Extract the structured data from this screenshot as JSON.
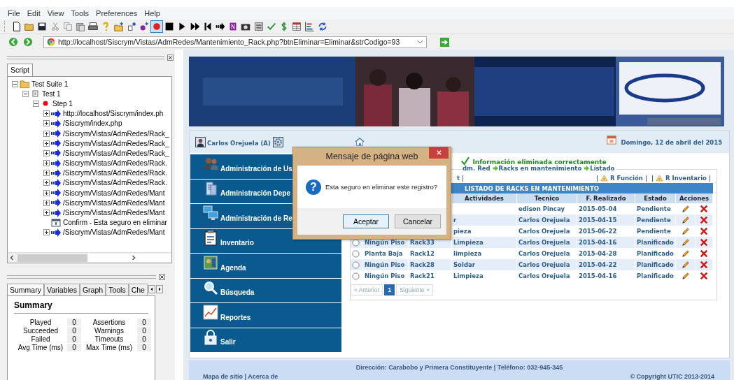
{
  "menu": [
    "File",
    "Edit",
    "View",
    "Tools",
    "Preferences",
    "Help"
  ],
  "toolbar": {
    "recording": true
  },
  "address": {
    "url": "http://localhost/Siscrym/Vistas/AdmRedes/Mantenimiento_Rack.php?btnEliminar=Eliminar&strCodigo=93"
  },
  "script_panel": {
    "tabs": [
      {
        "label": "Script",
        "selected": true
      }
    ],
    "tree": [
      {
        "kind": "suite",
        "label": "Test Suite 1",
        "expanded": true,
        "children": [
          {
            "kind": "test",
            "label": "Test 1",
            "expanded": true,
            "children": [
              {
                "kind": "step",
                "label": "Step 1",
                "expanded": true,
                "children": [
                  {
                    "kind": "request",
                    "label": "http://localhost/Siscrym/index.ph",
                    "expanded": false
                  },
                  {
                    "kind": "request",
                    "label": "/Siscrym/index.php",
                    "expanded": false
                  },
                  {
                    "kind": "request",
                    "label": "/Siscrym/Vistas/AdmRedes/Rack_",
                    "expanded": false
                  },
                  {
                    "kind": "request",
                    "label": "/Siscrym/Vistas/AdmRedes/Rack_",
                    "expanded": false
                  },
                  {
                    "kind": "request",
                    "label": "/Siscrym/Vistas/AdmRedes/Rack_",
                    "expanded": false
                  },
                  {
                    "kind": "request",
                    "label": "/Siscrym/Vistas/AdmRedes/Rack.",
                    "expanded": false
                  },
                  {
                    "kind": "request",
                    "label": "/Siscrym/Vistas/AdmRedes/Rack.",
                    "expanded": false
                  },
                  {
                    "kind": "request",
                    "label": "/Siscrym/Vistas/AdmRedes/Rack.",
                    "expanded": false
                  },
                  {
                    "kind": "request",
                    "label": "/Siscrym/Vistas/AdmRedes/Mant",
                    "expanded": false
                  },
                  {
                    "kind": "request",
                    "label": "/Siscrym/Vistas/AdmRedes/Mant",
                    "expanded": false
                  },
                  {
                    "kind": "request",
                    "label": "/Siscrym/Vistas/AdmRedes/Mant",
                    "expanded": false
                  },
                  {
                    "kind": "confirm",
                    "label": "Confirm - Esta seguro en eliminar"
                  },
                  {
                    "kind": "request",
                    "label": "/Siscrym/Vistas/AdmRedes/Mant",
                    "expanded": false
                  }
                ]
              }
            ]
          }
        ]
      }
    ]
  },
  "summary_panel": {
    "tabs": [
      {
        "label": "Summary",
        "selected": true
      },
      {
        "label": "Variables",
        "selected": false
      },
      {
        "label": "Graph",
        "selected": false
      },
      {
        "label": "Tools",
        "selected": false
      },
      {
        "label": "Che",
        "selected": false
      }
    ],
    "title": "Summary",
    "rows": [
      [
        {
          "label": "Played",
          "value": "0"
        },
        {
          "label": "Assertions",
          "value": "0"
        }
      ],
      [
        {
          "label": "Succeeded",
          "value": "0"
        },
        {
          "label": "Warnings",
          "value": "0"
        }
      ],
      [
        {
          "label": "Failed",
          "value": "0"
        },
        {
          "label": "Timeouts",
          "value": "0"
        }
      ],
      [
        {
          "label": "Avg Time (ms)",
          "value": "0"
        },
        {
          "label": "Max Time (ms)",
          "value": "0"
        }
      ]
    ]
  },
  "page": {
    "user": "Carlos Orejuela (A)",
    "date": "Domingo, 12 de abril del 2015",
    "menu": [
      {
        "label": "Administración de Us"
      },
      {
        "label": "Administración Depe"
      },
      {
        "label": "Administración de Re"
      },
      {
        "label": "Inventario"
      },
      {
        "label": "Agenda"
      },
      {
        "label": "Búsqueda"
      },
      {
        "label": "Reportes"
      },
      {
        "label": "Salir"
      }
    ],
    "message": "Información eliminada correctamente",
    "breadcrumb": [
      "dm. Red",
      "Racks en mantenimiento",
      "Listado"
    ],
    "links": {
      "left": "t |",
      "items": [
        {
          "before": "|",
          "label": "R Función",
          "after": "|"
        },
        {
          "before": "|",
          "label": "R Inventario",
          "after": "|"
        }
      ]
    },
    "table": {
      "title": "LISTADO DE RACKS EN MANTENIMIENTO",
      "columns": [
        "Actividades",
        "Tecnico",
        "F. Realizado",
        "Estado",
        "Acciones"
      ],
      "rows": [
        {
          "technician": "edison Pincay",
          "date": "2015-05-04",
          "status": "Pendiente"
        },
        {
          "activity": "r",
          "technician": "Carlos Orejuela",
          "date": "2015-04-15",
          "status": "Pendiente"
        },
        {
          "activity": "pieza",
          "technician": "Carlos Orejuela",
          "date": "2015-06-22",
          "status": "Pendiente"
        },
        {
          "selected": false,
          "floor": "Ningún Piso",
          "rack": "Rack33",
          "activity": "Limpieza",
          "technician": "Carlos Orejuela",
          "date": "2015-04-16",
          "status": "Planificado"
        },
        {
          "selected": false,
          "floor": "Planta Baja",
          "rack": "Rack12",
          "activity": "limpieza",
          "technician": "Carlos Orejuela",
          "date": "2015-04-28",
          "status": "Planificado"
        },
        {
          "selected": false,
          "floor": "Ningún Piso",
          "rack": "Rack28",
          "activity": "Soldar",
          "technician": "Carlos Orejuela",
          "date": "2015-04-22",
          "status": "Planificado"
        },
        {
          "selected": false,
          "floor": "Ningún Piso",
          "rack": "Rack21",
          "activity": "Limpieza",
          "technician": "Carlos Orejuela",
          "date": "2015-04-16",
          "status": "Planificado"
        }
      ]
    },
    "pagination": {
      "prev": "« Anterior",
      "pages": [
        {
          "label": "1",
          "selected": true
        }
      ],
      "next": "Siguiente »"
    },
    "footer": {
      "address": "Dirección: Carabobo y Primera Constituyente | Teléfono: 032-945-345",
      "left": "Mapa de sitio | Acerca de",
      "right": "© Copyright UTIC 2013-2014"
    }
  },
  "dialog": {
    "title": "Mensaje de página web",
    "icon": "?",
    "message": "Esta seguro en eliminar este registro?",
    "buttons": [
      {
        "label": "Aceptar",
        "selected": true
      },
      {
        "label": "Cancelar",
        "selected": false
      }
    ]
  }
}
